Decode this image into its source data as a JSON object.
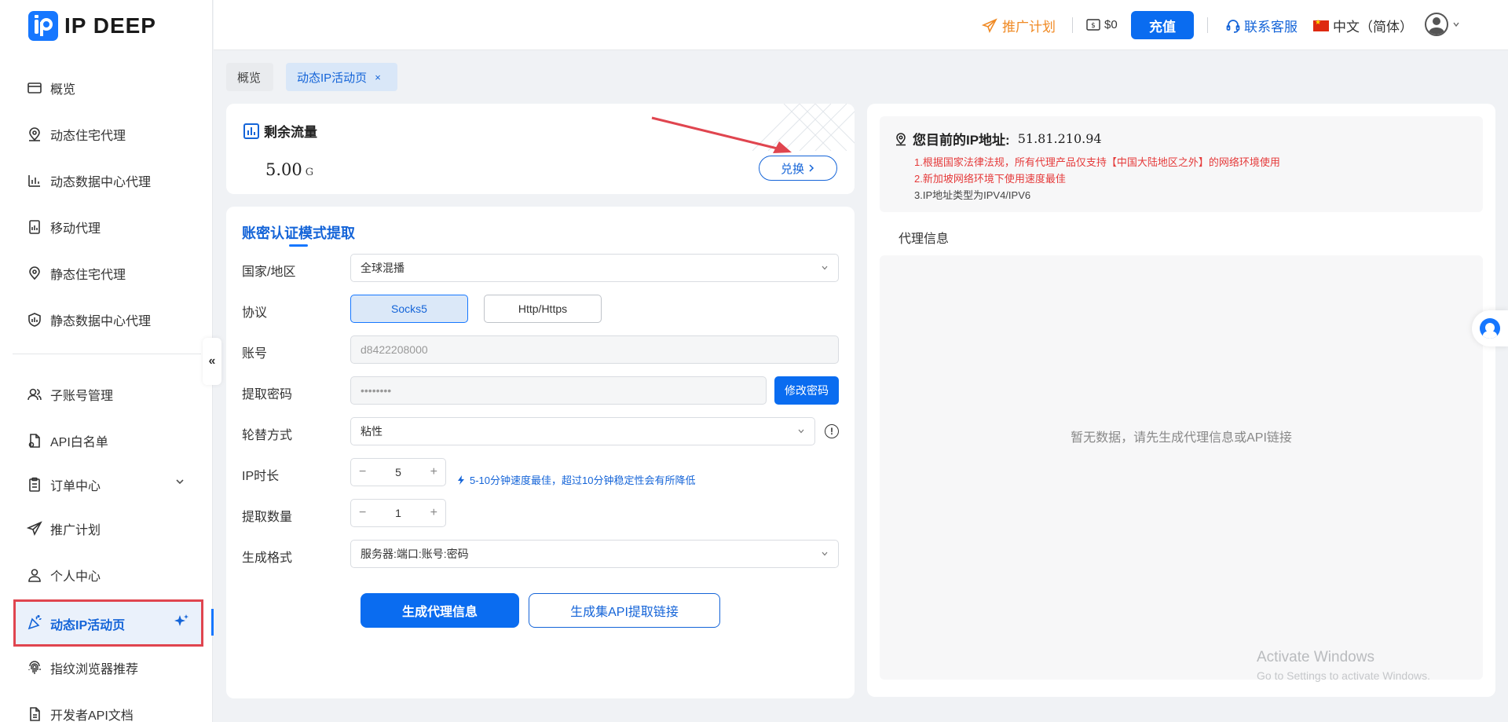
{
  "brand": {
    "name": "IP DEEP"
  },
  "sidebar": {
    "items": [
      {
        "label": "概览",
        "icon": "overview-icon"
      },
      {
        "label": "动态住宅代理",
        "icon": "location-icon"
      },
      {
        "label": "动态数据中心代理",
        "icon": "datacenter-icon"
      },
      {
        "label": "移动代理",
        "icon": "mobile-icon"
      },
      {
        "label": "静态住宅代理",
        "icon": "pin-icon"
      },
      {
        "label": "静态数据中心代理",
        "icon": "shield-icon"
      },
      {
        "label": "子账号管理",
        "icon": "users-icon"
      },
      {
        "label": "API白名单",
        "icon": "document-icon"
      },
      {
        "label": "订单中心",
        "icon": "clipboard-icon"
      },
      {
        "label": "推广计划",
        "icon": "send-icon"
      },
      {
        "label": "个人中心",
        "icon": "user-icon"
      },
      {
        "label": "动态IP活动页",
        "icon": "party-icon",
        "active": true
      },
      {
        "label": "指纹浏览器推荐",
        "icon": "fingerprint-icon"
      },
      {
        "label": "开发者API文档",
        "icon": "doc-icon"
      }
    ],
    "collapse_glyph": "«"
  },
  "header": {
    "promo": "推广计划",
    "balance": "$0",
    "recharge": "充值",
    "support": "联系客服",
    "language": "中文（简体）"
  },
  "tabs": [
    {
      "label": "概览"
    },
    {
      "label": "动态IP活动页",
      "close": "×"
    }
  ],
  "flow": {
    "title": "剩余流量",
    "value": "5.00",
    "unit": "G",
    "exchange": "兑换"
  },
  "form": {
    "title": "账密认证模式提取",
    "country_label": "国家/地区",
    "country_value": "全球混播",
    "protocol_label": "协议",
    "protocol_options": [
      "Socks5",
      "Http/Https"
    ],
    "account_label": "账号",
    "account_value": "d8422208000",
    "password_label": "提取密码",
    "password_value": "••••••••",
    "change_password": "修改密码",
    "rotation_label": "轮替方式",
    "rotation_value": "粘性",
    "info_glyph": "!",
    "duration_label": "IP时长",
    "duration_value": "5",
    "duration_tip": "5-10分钟速度最佳，超过10分钟稳定性会有所降低",
    "quantity_label": "提取数量",
    "quantity_value": "1",
    "format_label": "生成格式",
    "format_value": "服务器:端口:账号:密码",
    "generate": "生成代理信息",
    "generate_api": "生成集API提取链接"
  },
  "ip_panel": {
    "title": "您目前的IP地址:",
    "address": "51.81.210.94",
    "notes": [
      "1.根据国家法律法规，所有代理产品仅支持【中国大陆地区之外】的网络环境使用",
      "2.新加坡网络环境下使用速度最佳",
      "3.IP地址类型为IPV4/IPV6"
    ],
    "proxy_label": "代理信息",
    "empty": "暂无数据，请先生成代理信息或API链接"
  },
  "watermark": {
    "line1": "Activate Windows",
    "line2": "Go to Settings to activate Windows."
  },
  "colors": {
    "primary": "#0a6cf0",
    "accent_orange": "#f08a24",
    "warning_red": "#e53a3a",
    "highlight_border": "#e0454f"
  }
}
